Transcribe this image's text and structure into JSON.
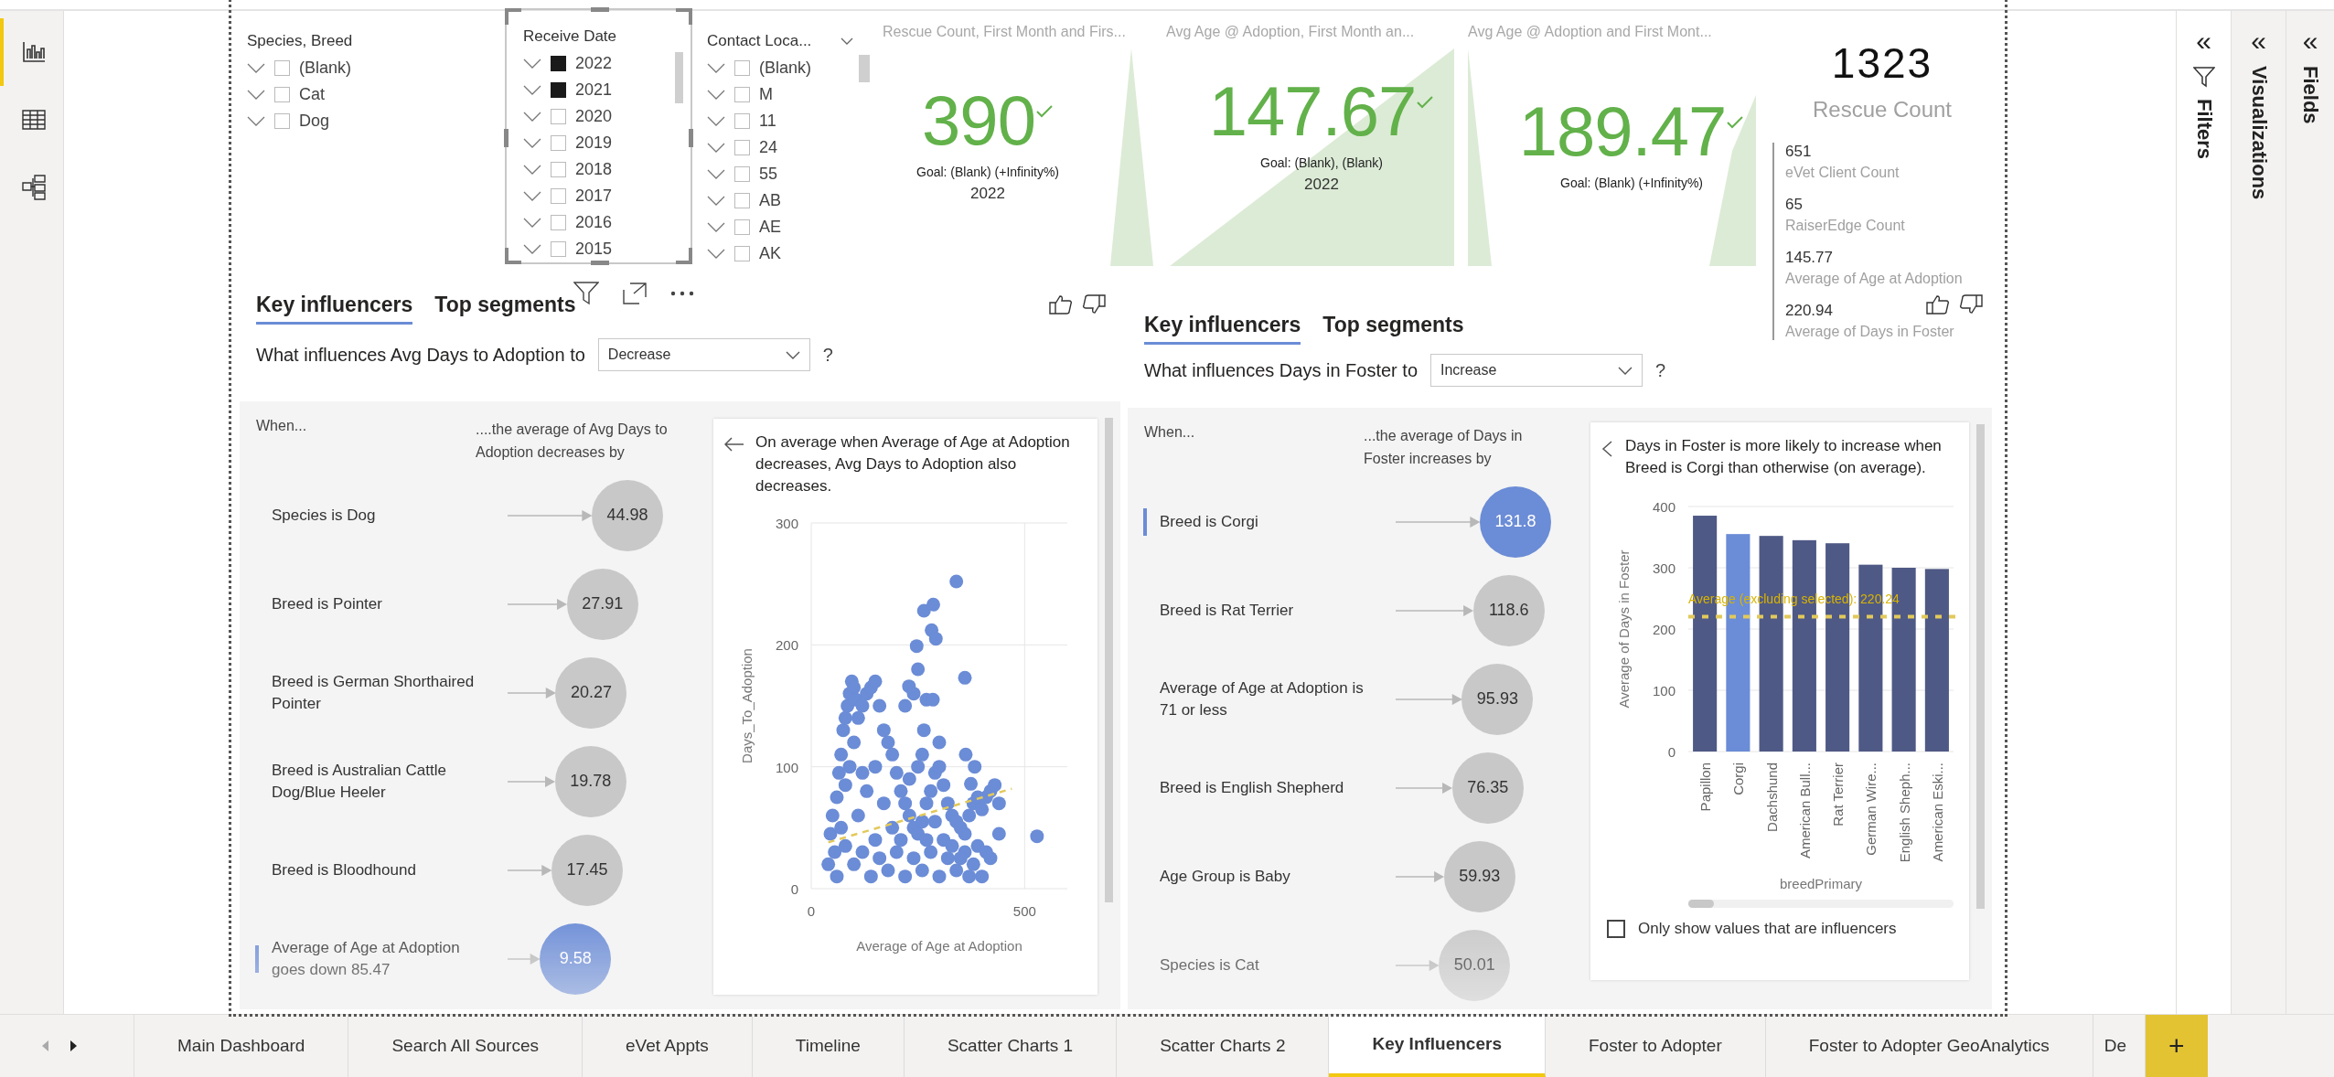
{
  "nav_rail": {
    "items": [
      {
        "kind": "report",
        "selected": true
      },
      {
        "kind": "data",
        "selected": false
      },
      {
        "kind": "model",
        "selected": false
      }
    ]
  },
  "slicers": [
    {
      "title": "Species, Breed",
      "framed": false,
      "scrollbar": false,
      "items": [
        {
          "label": "(Blank)",
          "checked": false
        },
        {
          "label": "Cat",
          "checked": false
        },
        {
          "label": "Dog",
          "checked": false
        }
      ]
    },
    {
      "title": "Receive Date",
      "framed": true,
      "scrollbar": true,
      "items": [
        {
          "label": "2022",
          "checked": true
        },
        {
          "label": "2021",
          "checked": true
        },
        {
          "label": "2020",
          "checked": false
        },
        {
          "label": "2019",
          "checked": false
        },
        {
          "label": "2018",
          "checked": false
        },
        {
          "label": "2017",
          "checked": false
        },
        {
          "label": "2016",
          "checked": false
        },
        {
          "label": "2015",
          "checked": false
        }
      ]
    },
    {
      "title": "Contact Loca...",
      "framed": false,
      "scrollbar": true,
      "items": [
        {
          "label": "(Blank)",
          "checked": false
        },
        {
          "label": "M",
          "checked": false
        },
        {
          "label": "11",
          "checked": false
        },
        {
          "label": "24",
          "checked": false
        },
        {
          "label": "55",
          "checked": false
        },
        {
          "label": "AB",
          "checked": false
        },
        {
          "label": "AE",
          "checked": false
        },
        {
          "label": "AK",
          "checked": false
        }
      ]
    }
  ],
  "kpis": [
    {
      "title": "Rescue Count, First Month and Firs...",
      "value": "390",
      "goal": "Goal: (Blank) (+Infinity%)",
      "period": "2022"
    },
    {
      "title": "Avg Age @ Adoption, First Month an...",
      "value": "147.67",
      "goal": "Goal: (Blank), (Blank)",
      "period": "2022"
    },
    {
      "title": "Avg Age @ Adoption and First Mont...",
      "value": "189.47",
      "goal": "Goal: (Blank) (+Infinity%)"
    }
  ],
  "card": {
    "value": "1323",
    "label": "Rescue Count",
    "rows": [
      {
        "value": "651",
        "label": "eVet Client Count"
      },
      {
        "value": "65",
        "label": "RaiserEdge Count"
      },
      {
        "value": "145.77",
        "label": "Average of Age at Adoption"
      },
      {
        "value": "220.94",
        "label": "Average of Days in Foster"
      }
    ]
  },
  "key_influencers": [
    {
      "tabs": [
        {
          "label": "Key influencers",
          "selected": true
        },
        {
          "label": "Top segments",
          "selected": false
        }
      ],
      "question": "What influences Avg Days to Adoption to",
      "dropdown": "Decrease",
      "help": "?",
      "when_header": "When...",
      "effect_header": "....the average of Avg Days to Adoption decreases by",
      "influencers": [
        {
          "label": "Species is Dog",
          "value": "44.98",
          "selected": false
        },
        {
          "label": "Breed is Pointer",
          "value": "27.91",
          "selected": false
        },
        {
          "label": "Breed is German Shorthaired Pointer",
          "value": "20.27",
          "selected": false
        },
        {
          "label": "Breed is Australian Cattle Dog/Blue Heeler",
          "value": "19.78",
          "selected": false
        },
        {
          "label": "Breed is Bloodhound",
          "value": "17.45",
          "selected": false
        },
        {
          "label": "Average of Age at Adoption goes down 85.47",
          "value": "9.58",
          "selected": true
        }
      ],
      "detail": {
        "text": "On average when Average of Age at Adoption decreases, Avg Days to Adoption also decreases.",
        "chart_data": {
          "type": "scatter",
          "xlabel": "Average of Age at Adoption",
          "ylabel": "Days_To_Adoption",
          "xlim": [
            0,
            600
          ],
          "ylim": [
            0,
            300
          ],
          "xticks": [
            0,
            500
          ],
          "yticks": [
            0,
            100,
            200,
            300
          ],
          "grid": true,
          "series": [
            {
              "color": "#6b8cd6",
              "x": [
                40,
                45,
                50,
                55,
                60,
                65,
                70,
                75,
                80,
                85,
                90,
                95,
                100,
                105,
                60,
                70,
                80,
                90,
                100,
                110,
                120,
                130,
                140,
                150,
                160,
                170,
                180,
                190,
                200,
                210,
                220,
                230,
                240,
                250,
                260,
                270,
                280,
                290,
                300,
                310,
                320,
                330,
                340,
                350,
                360,
                370,
                380,
                390,
                400,
                410,
                420,
                430,
                440,
                100,
                120,
                140,
                160,
                180,
                200,
                220,
                240,
                260,
                280,
                300,
                320,
                340,
                360,
                380,
                400,
                420,
                440,
                110,
                130,
                150,
                170,
                190,
                210,
                230,
                250,
                270,
                290,
                310,
                330,
                350,
                370,
                390,
                410,
                80,
                120,
                150,
                340,
                264,
                286,
                282,
                292,
                247,
                250,
                360,
                229,
                270,
                285,
                264,
                362,
                383,
                374,
                529,
                240,
                220,
                260,
                300
              ],
              "values": [
                20,
                45,
                60,
                30,
                75,
                95,
                110,
                130,
                140,
                150,
                160,
                170,
                165,
                155,
                10,
                50,
                85,
                100,
                120,
                140,
                150,
                160,
                165,
                170,
                150,
                130,
                120,
                110,
                95,
                80,
                70,
                60,
                50,
                45,
                55,
                70,
                80,
                95,
                100,
                85,
                70,
                60,
                55,
                50,
                45,
                60,
                70,
                75,
                65,
                75,
                80,
                85,
                70,
                20,
                30,
                10,
                25,
                15,
                30,
                10,
                25,
                15,
                30,
                10,
                25,
                15,
                30,
                20,
                10,
                25,
                45,
                60,
                80,
                100,
                70,
                50,
                40,
                90,
                100,
                40,
                55,
                40,
                35,
                25,
                10,
                35,
                30,
                35,
                95,
                40,
                252,
                228,
                233,
                212,
                205,
                199,
                180,
                173,
                166,
                155,
                155,
                130,
                110,
                100,
                86,
                43,
                160,
                150,
                110,
                120
              ]
            },
            {
              "type": "line",
              "line_style": "dashed",
              "color": "#e2c95a",
              "x": [
                40,
                470
              ],
              "values": [
                38,
                82
              ]
            }
          ]
        }
      }
    },
    {
      "tabs": [
        {
          "label": "Key influencers",
          "selected": true
        },
        {
          "label": "Top segments",
          "selected": false
        }
      ],
      "question": "What influences Days in Foster to",
      "dropdown": "Increase",
      "help": "?",
      "when_header": "When...",
      "effect_header": "...the average of Days in Foster increases by",
      "influencers": [
        {
          "label": "Breed is Corgi",
          "value": "131.8",
          "selected": true
        },
        {
          "label": "Breed is Rat Terrier",
          "value": "118.6",
          "selected": false
        },
        {
          "label": "Average of Age at Adoption is 71 or less",
          "value": "95.93",
          "selected": false
        },
        {
          "label": "Breed is English Shepherd",
          "value": "76.35",
          "selected": false
        },
        {
          "label": "Age Group is Baby",
          "value": "59.93",
          "selected": false
        },
        {
          "label": "Species is Cat",
          "value": "50.01",
          "selected": false
        }
      ],
      "detail": {
        "text": "Days in Foster is more likely to increase when Breed is Corgi than otherwise (on average).",
        "chart_data": {
          "type": "bar",
          "xlabel": "breedPrimary",
          "ylabel": "Average of Days in Foster",
          "stacked": true,
          "ylim": [
            0,
            400
          ],
          "yticks": [
            0,
            100,
            200,
            300,
            400
          ],
          "grid": true,
          "categories": [
            "Papillon",
            "Corgi",
            "Dachshund",
            "American Bull...",
            "Rat Terrier",
            "German Wire...",
            "English Sheph...",
            "American Eski..."
          ],
          "series": [
            {
              "color": "#4f5985",
              "values": [
                385,
                null,
                352,
                345,
                340,
                305,
                300,
                298
              ]
            },
            {
              "color": "#6b8cd6",
              "values": [
                null,
                355,
                null,
                null,
                null,
                null,
                null,
                null
              ]
            }
          ],
          "ref_lines": [
            {
              "axis": "y",
              "value": 220.24,
              "label": "Average (excluding selected): 220.24"
            }
          ]
        },
        "filter_option": {
          "label": "Only show values that are influencers",
          "checked": false
        }
      }
    }
  ],
  "panes": [
    {
      "kind": "filters",
      "collapse": "«",
      "label": "Filters"
    },
    {
      "kind": "plain",
      "collapse": "«",
      "label": "Visualizations"
    },
    {
      "kind": "plain",
      "collapse": "«",
      "label": "Fields"
    }
  ],
  "page_tabs": [
    {
      "label": "Main Dashboard",
      "selected": false
    },
    {
      "label": "Search All Sources",
      "selected": false
    },
    {
      "label": "eVet Appts",
      "selected": false
    },
    {
      "label": "Timeline",
      "selected": false
    },
    {
      "label": "Scatter Charts 1",
      "selected": false
    },
    {
      "label": "Scatter Charts 2",
      "selected": false
    },
    {
      "label": "Key Influencers",
      "selected": true
    },
    {
      "label": "Foster to Adopter",
      "selected": false
    },
    {
      "label": "Foster to Adopter GeoAnalytics",
      "selected": false
    },
    {
      "label": "De",
      "selected": false
    }
  ],
  "add_page": "+"
}
